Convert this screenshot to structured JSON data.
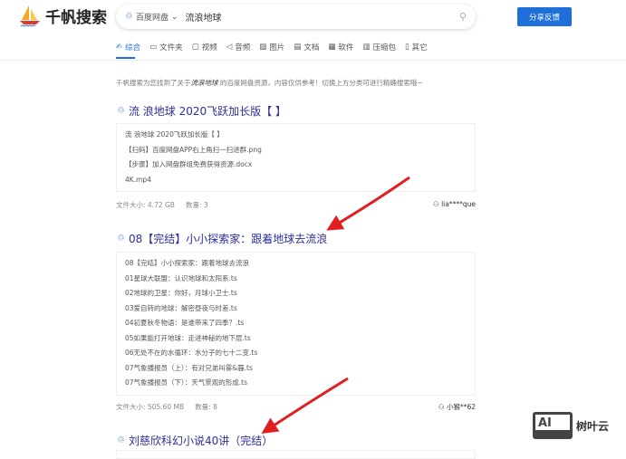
{
  "header": {
    "logo_text": "千帆搜索",
    "search_source": "百度网盘",
    "search_query": "流浪地球",
    "share_button": "分享反馈"
  },
  "tabs": [
    {
      "icon": "✍",
      "label": "综合"
    },
    {
      "icon": "▭",
      "label": "文件夹"
    },
    {
      "icon": "▢",
      "label": "视频"
    },
    {
      "icon": "◁",
      "label": "音频"
    },
    {
      "icon": "▨",
      "label": "图片"
    },
    {
      "icon": "▤",
      "label": "文档"
    },
    {
      "icon": "▦",
      "label": "软件"
    },
    {
      "icon": "▥",
      "label": "压缩包"
    },
    {
      "icon": "▯",
      "label": "其它"
    }
  ],
  "intro": {
    "prefix": "千帆搜索为您找到了关于",
    "keyword": "流浪地球",
    "suffix": "的百度网盘资源，内容仅供参考！切换上方分类可进行精确搜索哦~"
  },
  "results": [
    {
      "title": "流 浪地球 2020飞跃加长版【 】",
      "files": [
        "流 浪地球 2020飞跃加长版【 】",
        "【扫码】百度网盘APP右上角扫一扫进群.png",
        "【步骤】加入网盘群组免费获得资源.docx",
        "4K.mp4"
      ],
      "size": "文件大小: 4.72 GB",
      "count": "数量: 3",
      "user": "lia****que"
    },
    {
      "title": "08【完结】小小探索家：跟着地球去流浪",
      "files": [
        "08【完结】小小探索家：跟着地球去流浪",
        "01星球大联盟：认识地球和太阳系.ts",
        "02地球的卫星：你好，月球小卫士.ts",
        "03爱自转的地球：解密昼夜与时差.ts",
        "04初夏秋冬物语：是谁带来了四季？.ts",
        "05如果能打开地球：走进神秘的地下层.ts",
        "06无处不在的水循环：水分子的七十二变.ts",
        "07气象播报员（上）：有对兄弟叫雾&霾.ts",
        "07气象播报员（下）：天气景观的形成.ts"
      ],
      "size": "文件大小: 505.60 MB",
      "count": "数量: 8",
      "user": "小猴**62"
    },
    {
      "title": "刘慈欣科幻小说40讲（完结）"
    }
  ],
  "watermark": {
    "logo": "AI",
    "text": "树叶云"
  },
  "colors": {
    "accent": "#1e6fd9",
    "title": "#2c2f9a",
    "arrow": "#e02020"
  }
}
